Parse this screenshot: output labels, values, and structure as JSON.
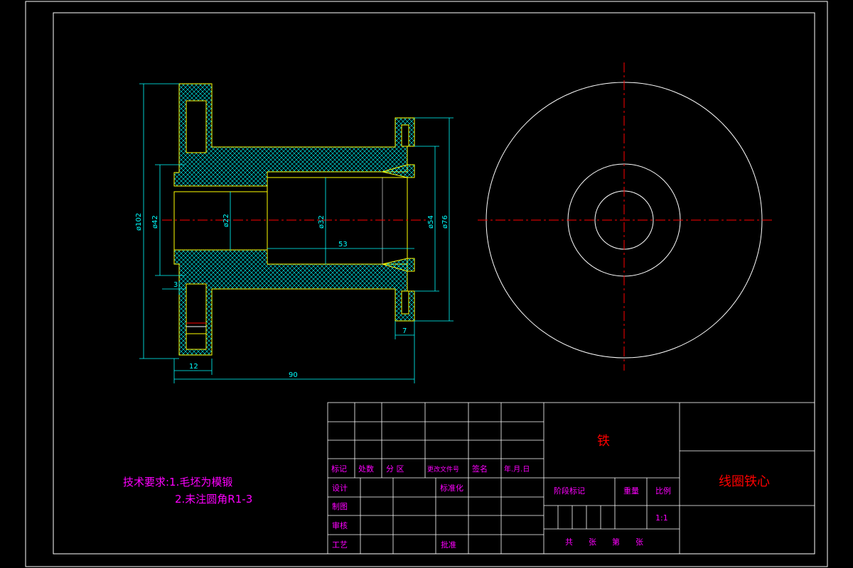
{
  "colors": {
    "background": "#000000",
    "frame": "#ffffff",
    "dimension": "#00ffff",
    "outline": "#ffff00",
    "hatch": "#00ffff",
    "centerline": "#ff0000",
    "view_circle": "#ffffff",
    "tb_label": "#ff00ff",
    "tb_red": "#ff0000",
    "notes": "#ff00ff"
  },
  "dimensions": {
    "d102": "ø102",
    "d42": "ø42",
    "d22": "ø22",
    "d32": "ø32",
    "d54": "ø54",
    "d76": "ø76",
    "len53": "53",
    "len90": "90",
    "len12": "12",
    "len7": "7",
    "len3": "3"
  },
  "notes": {
    "line1": "技术要求:1.毛坯为模锻",
    "line2": "2.未注圆角R1-3"
  },
  "title_block": {
    "material": "铁",
    "part_name": "线圈铁心",
    "labels": {
      "mark": "标记",
      "count": "处数",
      "zone": "分 区",
      "change_doc": "更改文件号",
      "signature": "签名",
      "date": "年.月.日",
      "design": "设计",
      "standardize": "标准化",
      "stage_mark": "阶段标记",
      "weight": "重量",
      "scale": "比例",
      "drawing": "制图",
      "review": "审核",
      "process": "工艺",
      "approve": "批准",
      "scale_value": "1:1",
      "sheets": "共　　张　　第　　张"
    }
  }
}
